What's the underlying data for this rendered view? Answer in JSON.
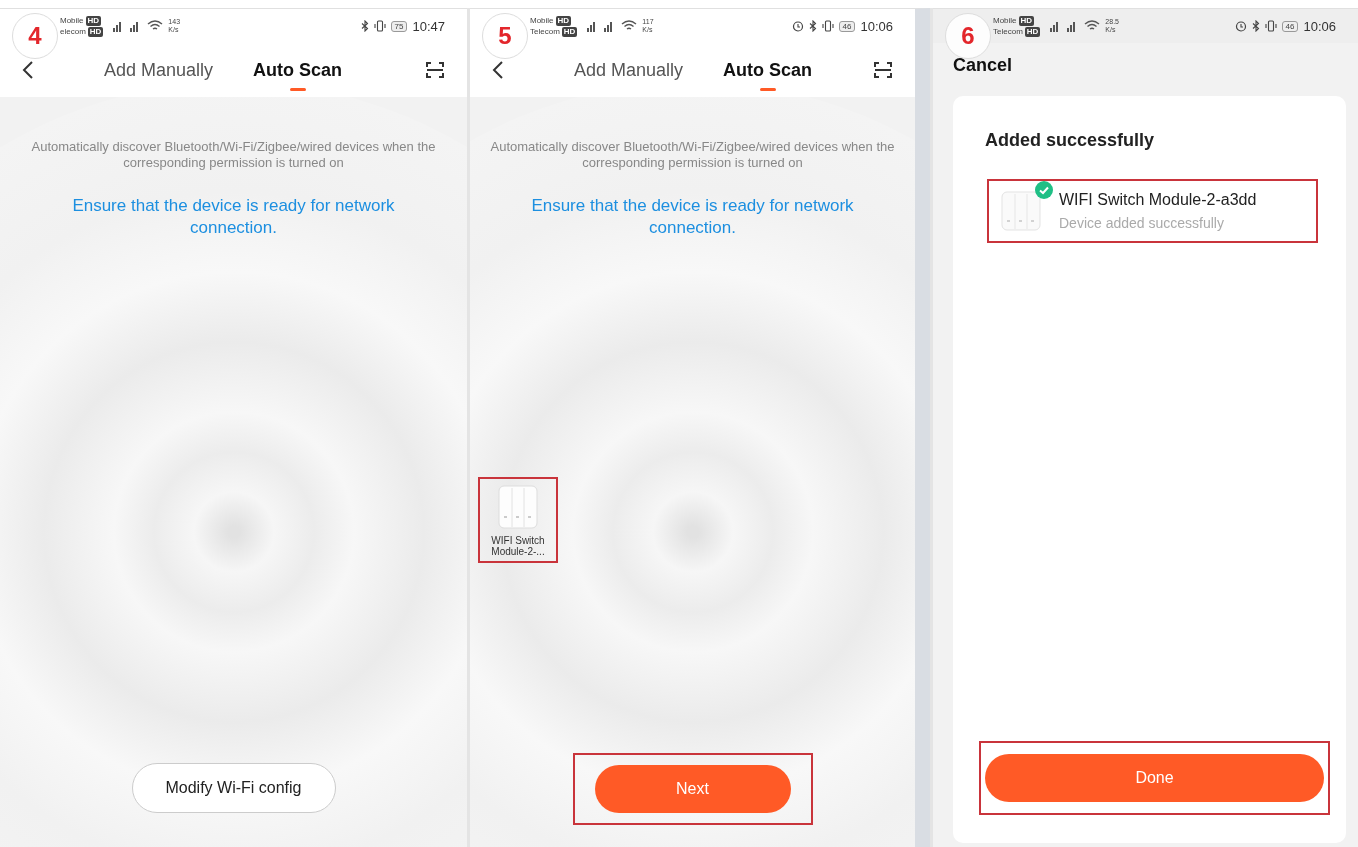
{
  "screens": [
    {
      "kind": "scan",
      "step": "4",
      "status_bar": {
        "carriers": [
          {
            "name": "Mobile",
            "badge": "HD"
          },
          {
            "name": "elecom",
            "badge": "HD"
          }
        ],
        "speed": "143",
        "speed_unit": "K/s",
        "alarm": false,
        "battery": "75",
        "time": "10:47"
      },
      "tabs": [
        {
          "label": "Add Manually",
          "selected": false
        },
        {
          "label": "Auto Scan",
          "selected": true
        }
      ],
      "hint": "Automatically discover Bluetooth/Wi-Fi/Zigbee/wired devices when the corresponding permission is turned on",
      "notice": "Ensure that the device is ready for network connection.",
      "button": {
        "label": "Modify Wi-Fi config",
        "kind": "outline",
        "highlighted": false
      }
    },
    {
      "kind": "scan",
      "step": "5",
      "status_bar": {
        "carriers": [
          {
            "name": "Mobile",
            "badge": "HD"
          },
          {
            "name": "Telecom",
            "badge": "HD"
          }
        ],
        "speed": "117",
        "speed_unit": "K/s",
        "alarm": true,
        "battery": "46",
        "time": "10:06"
      },
      "tabs": [
        {
          "label": "Add Manually",
          "selected": false
        },
        {
          "label": "Auto Scan",
          "selected": true
        }
      ],
      "hint": "Automatically discover Bluetooth/Wi-Fi/Zigbee/wired devices when the corresponding permission is turned on",
      "notice": "Ensure that the device is ready for network connection.",
      "found_device": {
        "label": "WIFI Switch Module-2-...",
        "highlighted": true
      },
      "button": {
        "label": "Next",
        "kind": "primary",
        "highlighted": true
      }
    },
    {
      "kind": "result",
      "step": "6",
      "status_bar": {
        "carriers": [
          {
            "name": "Mobile",
            "badge": "HD"
          },
          {
            "name": "Telecom",
            "badge": "HD"
          }
        ],
        "speed": "28.5",
        "speed_unit": "K/s",
        "alarm": true,
        "battery": "46",
        "time": "10:06"
      },
      "cancel": "Cancel",
      "title": "Added successfully",
      "devices": [
        {
          "name": "WIFI Switch Module-2-a3dd",
          "status": "Device added successfully",
          "added": true,
          "highlighted": true
        }
      ],
      "button": {
        "label": "Done",
        "kind": "primary",
        "highlighted": true
      }
    }
  ]
}
